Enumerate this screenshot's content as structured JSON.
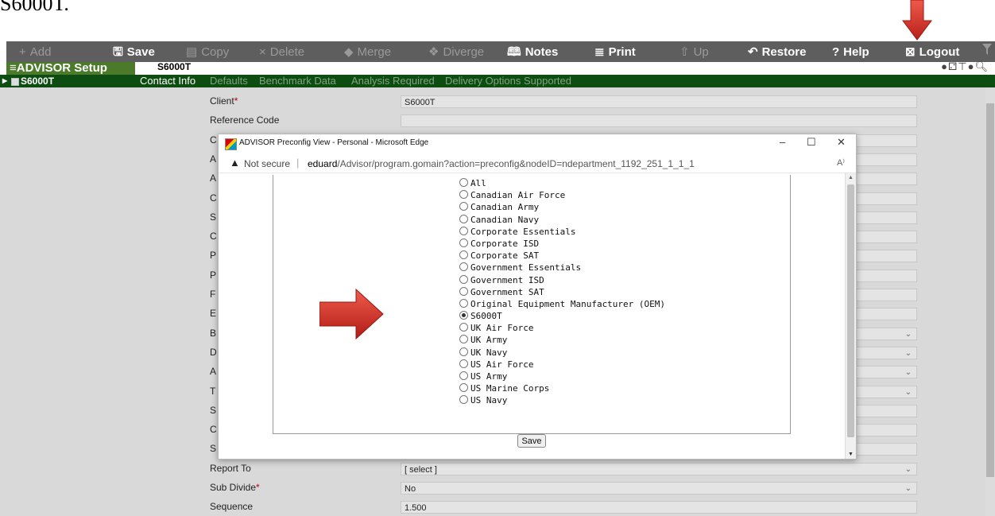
{
  "document_text": "S6000T.",
  "toolbar": {
    "buttons": [
      {
        "icon": "plus-icon",
        "glyph": "+",
        "label": "Add",
        "enabled": false
      },
      {
        "icon": "save-icon",
        "glyph": "🖫",
        "label": "Save",
        "enabled": true
      },
      {
        "icon": "copy-icon",
        "glyph": "▤",
        "label": "Copy",
        "enabled": false
      },
      {
        "icon": "delete-icon",
        "glyph": "×",
        "label": "Delete",
        "enabled": false
      },
      {
        "icon": "merge-icon",
        "glyph": "◆",
        "label": "Merge",
        "enabled": false
      },
      {
        "icon": "diverge-icon",
        "glyph": "❖",
        "label": "Diverge",
        "enabled": false
      },
      {
        "icon": "notes-icon",
        "glyph": "🕮",
        "label": "Notes",
        "enabled": true
      },
      {
        "icon": "print-icon",
        "glyph": "≣",
        "label": "Print",
        "enabled": true
      },
      {
        "icon": "up-icon",
        "glyph": "⇧",
        "label": "Up",
        "enabled": false
      },
      {
        "icon": "restore-icon",
        "glyph": "↶",
        "label": "Restore",
        "enabled": true
      },
      {
        "icon": "help-icon",
        "glyph": "?",
        "label": "Help",
        "enabled": true
      },
      {
        "icon": "logout-icon",
        "glyph": "⊠",
        "label": "Logout",
        "enabled": true
      }
    ]
  },
  "header": {
    "app_title": "ADVISOR Setup",
    "breadcrumb": "S6000T",
    "icons": [
      "record-icon",
      "hierarchy-icon",
      "filter-icon",
      "info-icon",
      "zoom-icon"
    ]
  },
  "tree": {
    "items": [
      {
        "label": "S6000T"
      }
    ]
  },
  "tabs": [
    {
      "label": "Contact Info",
      "active": true
    },
    {
      "label": "Defaults",
      "active": false
    },
    {
      "label": "Benchmark Data",
      "active": false
    },
    {
      "label": "Analysis Required",
      "active": false
    },
    {
      "label": "Delivery Options Supported",
      "active": false
    }
  ],
  "form": {
    "rows": [
      {
        "label": "Client",
        "required": true,
        "value": "S6000T",
        "dropdown": false
      },
      {
        "label": "Reference Code",
        "required": false,
        "value": "",
        "dropdown": false
      },
      {
        "label": "C",
        "required": false,
        "value": "",
        "dropdown": false
      },
      {
        "label": "A",
        "required": false,
        "value": "",
        "dropdown": false
      },
      {
        "label": "A",
        "required": false,
        "value": "",
        "dropdown": false
      },
      {
        "label": "C",
        "required": false,
        "value": "",
        "dropdown": false
      },
      {
        "label": "S",
        "required": false,
        "value": "",
        "dropdown": false
      },
      {
        "label": "C",
        "required": false,
        "value": "",
        "dropdown": false
      },
      {
        "label": "P",
        "required": false,
        "value": "",
        "dropdown": false
      },
      {
        "label": "P",
        "required": false,
        "value": "",
        "dropdown": false
      },
      {
        "label": "F",
        "required": false,
        "value": "",
        "dropdown": false
      },
      {
        "label": "E",
        "required": false,
        "value": "",
        "dropdown": false
      },
      {
        "label": "B",
        "required": false,
        "value": "",
        "dropdown": true
      },
      {
        "label": "D",
        "required": false,
        "value": "",
        "dropdown": true
      },
      {
        "label": "A",
        "required": false,
        "value": "",
        "dropdown": true
      },
      {
        "label": "T",
        "required": false,
        "value": "",
        "dropdown": true
      },
      {
        "label": "S",
        "required": false,
        "value": "",
        "dropdown": false
      },
      {
        "label": "C",
        "required": false,
        "value": "",
        "dropdown": false
      },
      {
        "label": "S",
        "required": false,
        "value": "",
        "dropdown": false
      },
      {
        "label": "Report To",
        "required": false,
        "value": "[ select ]",
        "dropdown": true
      },
      {
        "label": "Sub Divide",
        "required": true,
        "value": "No",
        "dropdown": true
      },
      {
        "label": "Sequence",
        "required": false,
        "value": "1.500",
        "dropdown": false
      }
    ]
  },
  "popup": {
    "title": "ADVISOR Preconfig View - Personal - Microsoft Edge",
    "window_controls": [
      "–",
      "☐",
      "✕"
    ],
    "security": "Not secure",
    "url_host": "eduard",
    "url_path": "/Advisor/program.gomain?action=preconfig&nodeID=ndepartment_1192_251_1_1_1",
    "reader_icon": "A⁾",
    "options": [
      {
        "label": "All",
        "selected": false
      },
      {
        "label": "Canadian Air Force",
        "selected": false
      },
      {
        "label": "Canadian Army",
        "selected": false
      },
      {
        "label": "Canadian Navy",
        "selected": false
      },
      {
        "label": "Corporate Essentials",
        "selected": false
      },
      {
        "label": "Corporate ISD",
        "selected": false
      },
      {
        "label": "Corporate SAT",
        "selected": false
      },
      {
        "label": "Government Essentials",
        "selected": false
      },
      {
        "label": "Government ISD",
        "selected": false
      },
      {
        "label": "Government SAT",
        "selected": false
      },
      {
        "label": "Original Equipment Manufacturer (OEM)",
        "selected": false
      },
      {
        "label": "S6000T",
        "selected": true
      },
      {
        "label": "UK Air Force",
        "selected": false
      },
      {
        "label": "UK Army",
        "selected": false
      },
      {
        "label": "UK Navy",
        "selected": false
      },
      {
        "label": "US Air Force",
        "selected": false
      },
      {
        "label": "US Army",
        "selected": false
      },
      {
        "label": "US Marine Corps",
        "selected": false
      },
      {
        "label": "US Navy",
        "selected": false
      }
    ],
    "save_label": "Save"
  },
  "colors": {
    "toolbar_bg": "#5e5e5e",
    "app_title_bg": "#4a7a2a",
    "tab_strip_bg": "#0e4d12",
    "panel_bg": "#d9d9d9",
    "required": "#c00000",
    "arrow": "#d9352a"
  }
}
